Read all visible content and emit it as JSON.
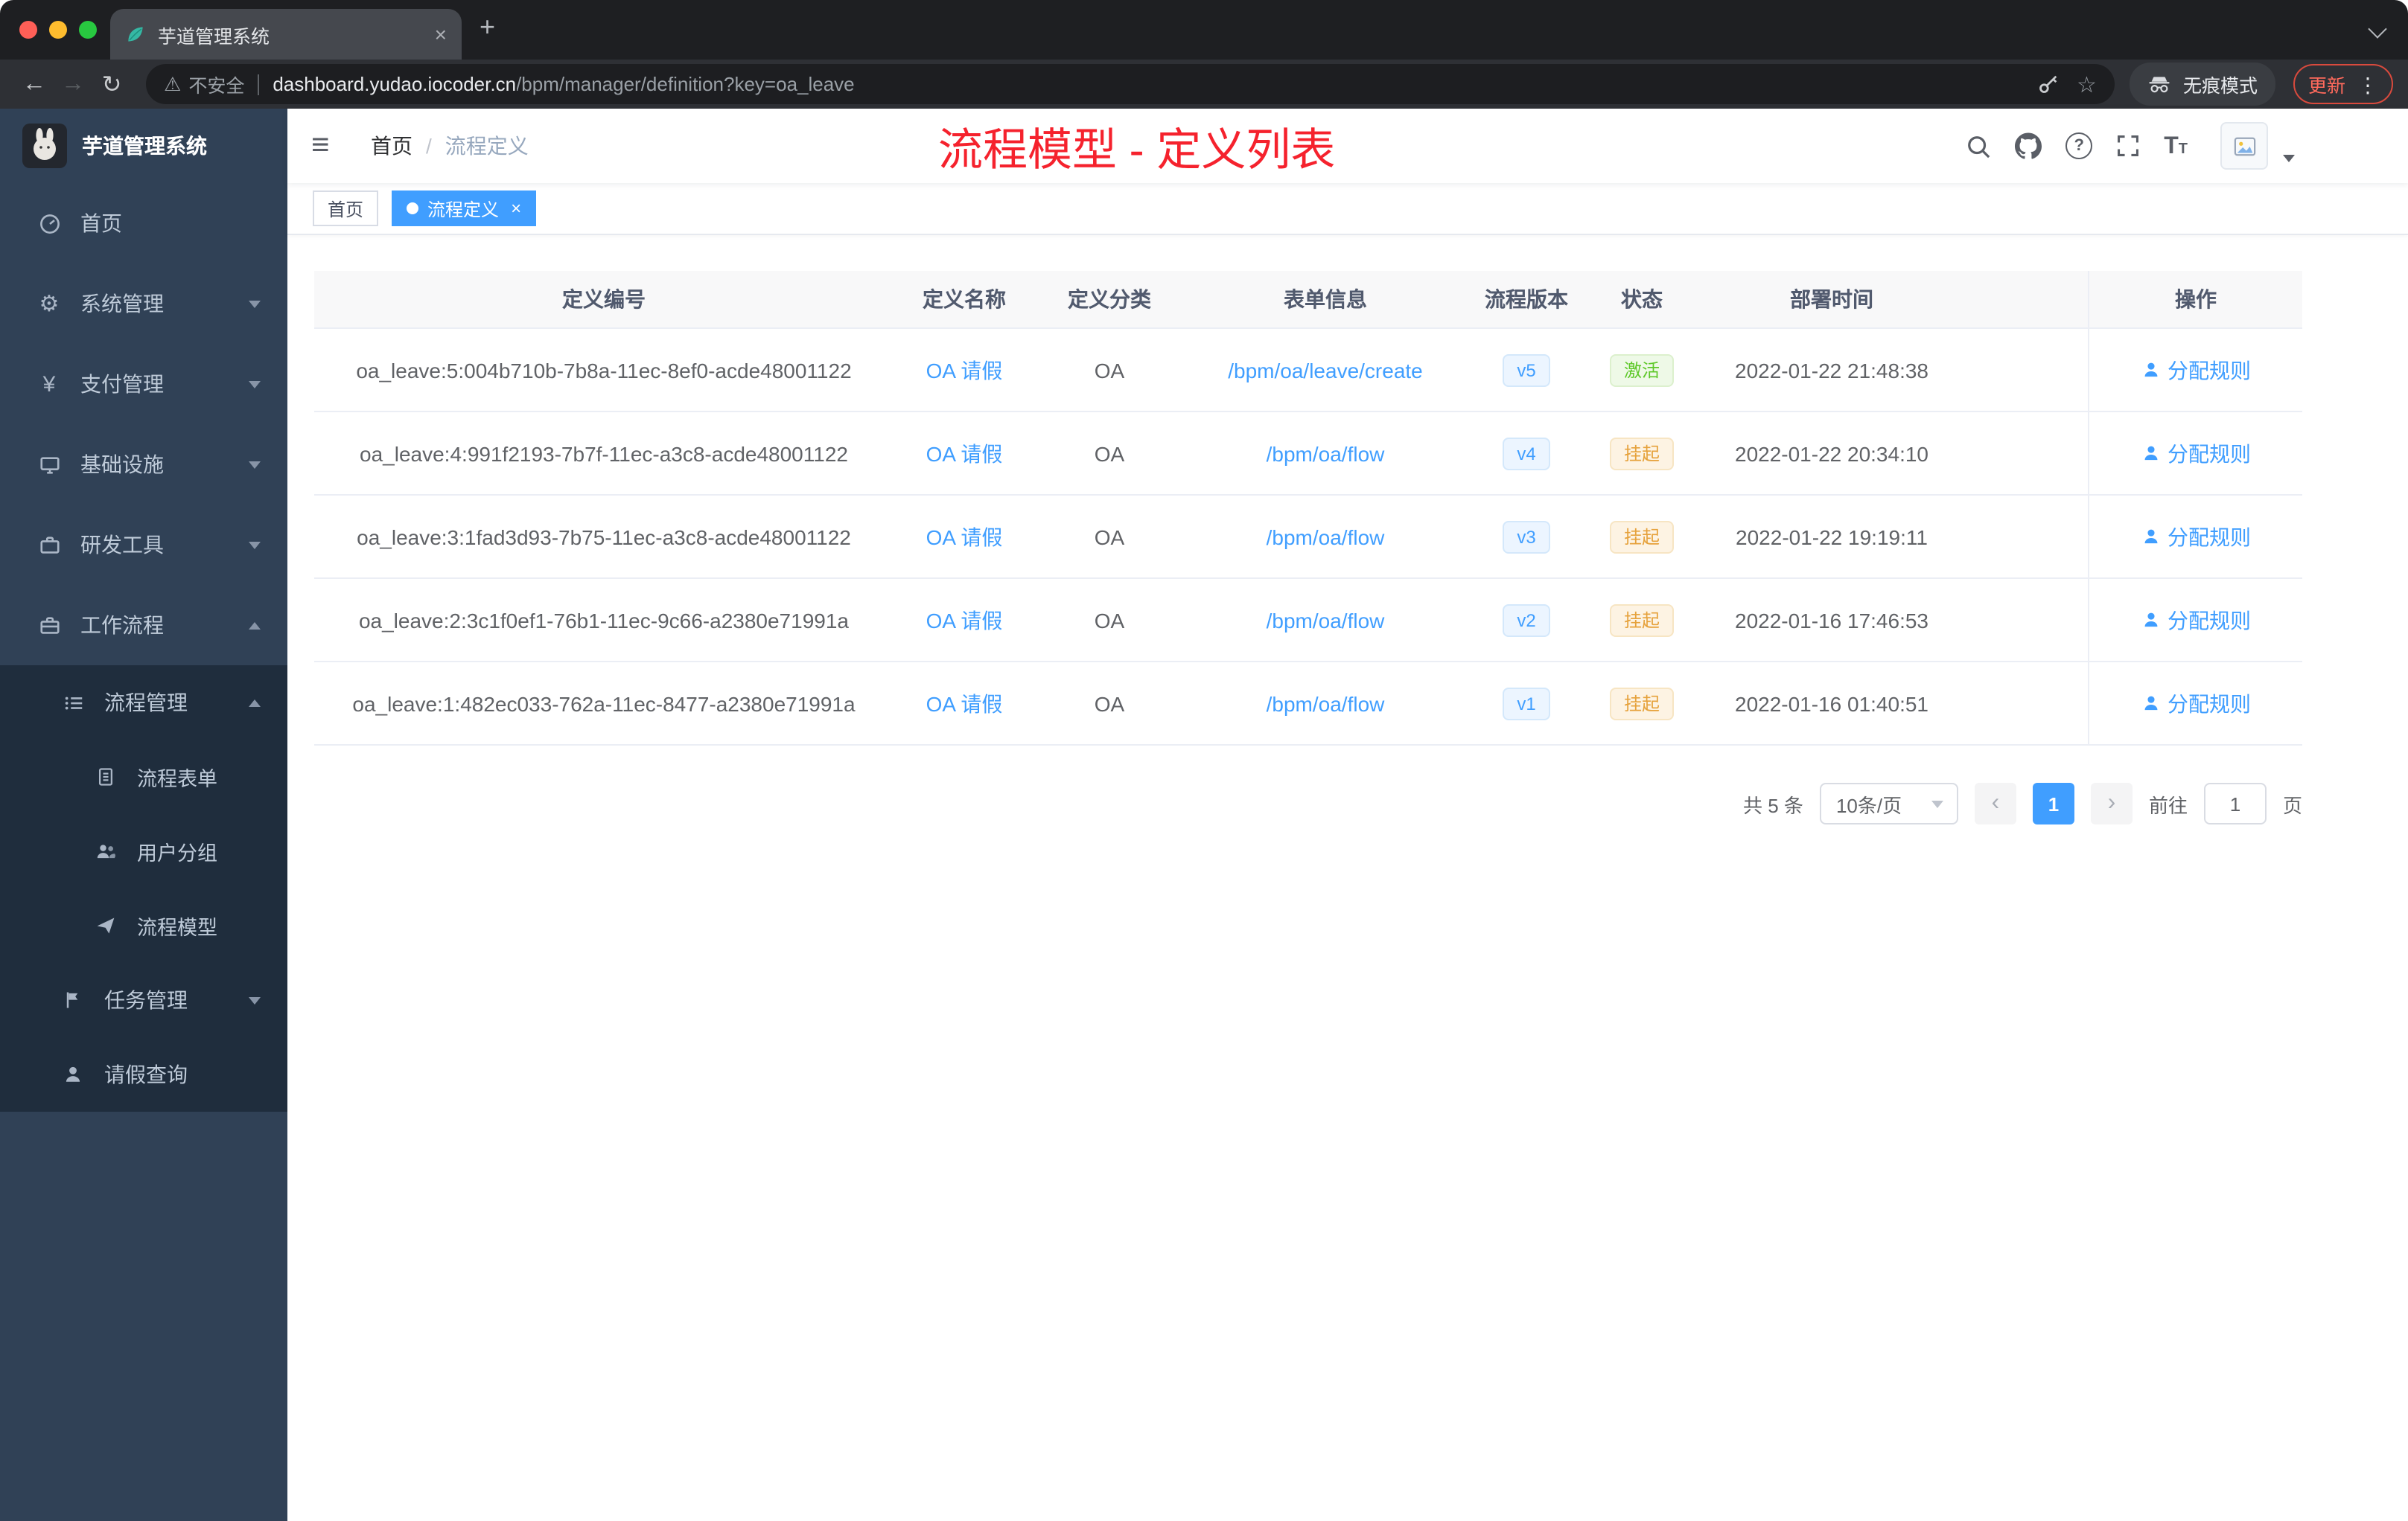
{
  "colors": {
    "accent": "#409eff",
    "success": "#5ec829",
    "warning": "#e6a23c",
    "annotation_red": "#f5222d",
    "sidebar_bg": "#304156",
    "submenu_bg": "#1f2d3d"
  },
  "icons": {
    "close": "×",
    "new_tab": "+",
    "back": "←",
    "forward": "→",
    "reload": "↻",
    "warning": "⚠",
    "star": "☆",
    "menu_dots": "⋮",
    "hamburger": "≡",
    "question": "?",
    "text_size": "T",
    "prev": "‹",
    "next": "›",
    "breadcrumb_sep": "/",
    "gear": "⚙",
    "yen": "¥"
  },
  "browser": {
    "tab_title": "芋道管理系统",
    "security_label": "不安全",
    "url_domain": "dashboard.yudao.iocoder.cn",
    "url_path": "/bpm/manager/definition?key=oa_leave",
    "incognito_label": "无痕模式",
    "update_label": "更新"
  },
  "sidebar": {
    "logo_title": "芋道管理系统",
    "items": [
      {
        "label": "首页"
      },
      {
        "label": "系统管理"
      },
      {
        "label": "支付管理"
      },
      {
        "label": "基础设施"
      },
      {
        "label": "研发工具"
      },
      {
        "label": "工作流程"
      }
    ],
    "submenu": [
      {
        "label": "流程管理"
      },
      {
        "label": "流程表单"
      },
      {
        "label": "用户分组"
      },
      {
        "label": "流程模型"
      },
      {
        "label": "任务管理"
      },
      {
        "label": "请假查询"
      }
    ]
  },
  "header": {
    "breadcrumb": [
      "首页",
      "流程定义"
    ],
    "annotation_title": "流程模型 - 定义列表"
  },
  "tags": {
    "inactive": "首页",
    "active": "流程定义"
  },
  "table": {
    "columns": [
      "定义编号",
      "定义名称",
      "定义分类",
      "表单信息",
      "流程版本",
      "状态",
      "部署时间",
      "操作"
    ],
    "rows": [
      {
        "id": "oa_leave:5:004b710b-7b8a-11ec-8ef0-acde48001122",
        "name": "OA 请假",
        "category": "OA",
        "form": "/bpm/oa/leave/create",
        "version": "v5",
        "status": "激活",
        "time": "2022-01-22 21:48:38",
        "action": "分配规则"
      },
      {
        "id": "oa_leave:4:991f2193-7b7f-11ec-a3c8-acde48001122",
        "name": "OA 请假",
        "category": "OA",
        "form": "/bpm/oa/flow",
        "version": "v4",
        "status": "挂起",
        "time": "2022-01-22 20:34:10",
        "action": "分配规则"
      },
      {
        "id": "oa_leave:3:1fad3d93-7b75-11ec-a3c8-acde48001122",
        "name": "OA 请假",
        "category": "OA",
        "form": "/bpm/oa/flow",
        "version": "v3",
        "status": "挂起",
        "time": "2022-01-22 19:19:11",
        "action": "分配规则"
      },
      {
        "id": "oa_leave:2:3c1f0ef1-76b1-11ec-9c66-a2380e71991a",
        "name": "OA 请假",
        "category": "OA",
        "form": "/bpm/oa/flow",
        "version": "v2",
        "status": "挂起",
        "time": "2022-01-16 17:46:53",
        "action": "分配规则"
      },
      {
        "id": "oa_leave:1:482ec033-762a-11ec-8477-a2380e71991a",
        "name": "OA 请假",
        "category": "OA",
        "form": "/bpm/oa/flow",
        "version": "v1",
        "status": "挂起",
        "time": "2022-01-16 01:40:51",
        "action": "分配规则"
      }
    ]
  },
  "pagination": {
    "total": "共 5 条",
    "page_size": "10条/页",
    "current": "1",
    "goto_label": "前往",
    "goto_value": "1",
    "unit": "页"
  }
}
